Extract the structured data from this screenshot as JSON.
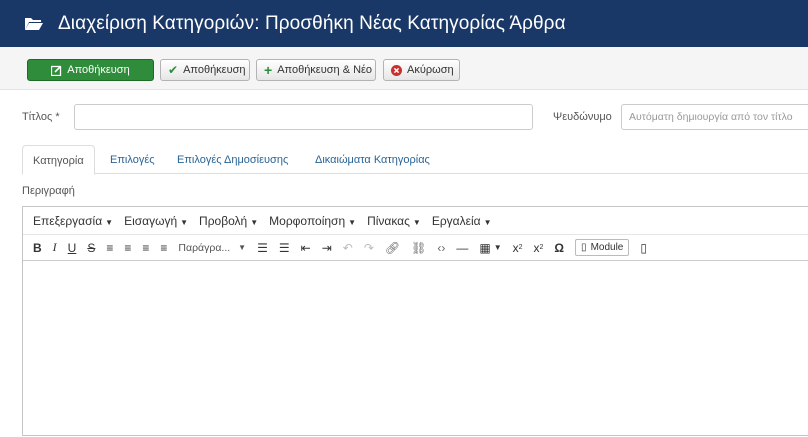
{
  "header": {
    "title": "Διαχείριση Κατηγοριών: Προσθήκη Νέας Κατηγορίας Άρθρα"
  },
  "toolbar": {
    "save_primary": "Αποθήκευση",
    "save_close": "Αποθήκευση",
    "save_new": "Αποθήκευση & Νέο",
    "cancel": "Ακύρωση"
  },
  "form": {
    "title_label": "Τίτλος *",
    "title_value": "",
    "alias_label": "Ψευδώνυμο",
    "alias_placeholder": "Αυτόματη δημιουργία από τον τίτλο"
  },
  "tabs": [
    "Κατηγορία",
    "Επιλογές",
    "Επιλογές Δημοσίευσης",
    "Δικαιώματα Κατηγορίας"
  ],
  "description_label": "Περιγραφή",
  "editor": {
    "menus": [
      "Επεξεργασία",
      "Εισαγωγή",
      "Προβολή",
      "Μορφοποίηση",
      "Πίνακας",
      "Εργαλεία"
    ],
    "format_select": "Παράγρα...",
    "module_label": "Module"
  },
  "colors": {
    "header_bg": "#1a3867",
    "save_green": "#2f8c3a",
    "cancel_red": "#c9302c",
    "link_blue": "#2a6496"
  }
}
